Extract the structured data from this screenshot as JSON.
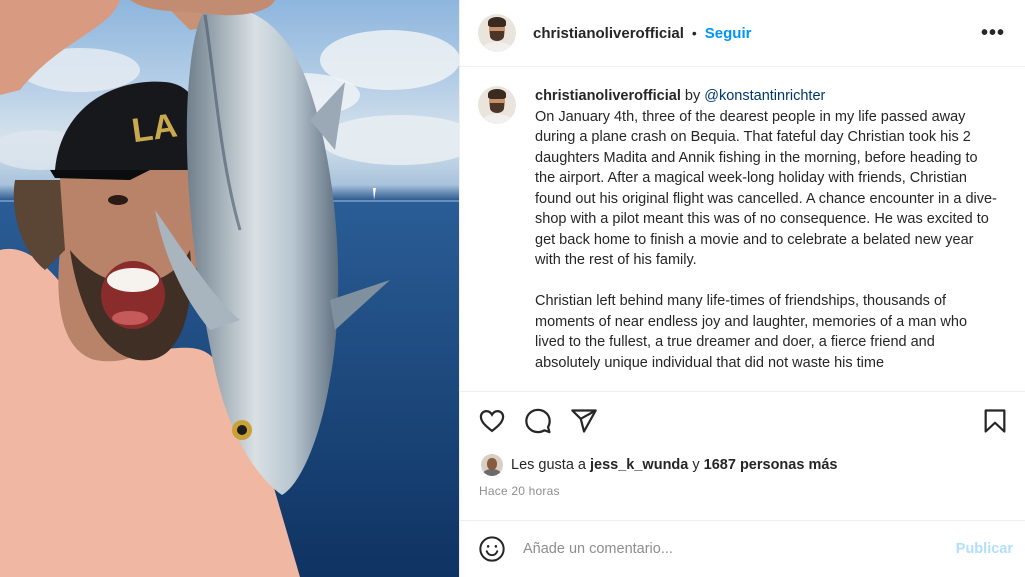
{
  "post": {
    "author": "christianoliverofficial",
    "follow_label": "Seguir",
    "dot": "•",
    "more_label": "•••"
  },
  "caption": {
    "username": "christianoliverofficial",
    "by_text": "by",
    "mention": "@konstantinrichter",
    "paragraph1": "On January 4th, three of the dearest people in my life passed away during a plane crash on Bequia. That fateful day Christian took his 2 daughters Madita and Annik fishing in the morning, before heading to the airport. After a magical week-long holiday with friends, Christian found out his original flight was cancelled. A chance encounter in a dive-shop with a pilot meant this was of no consequence. He was excited to get back home to finish a movie and to celebrate a belated new year with the rest of his family.",
    "paragraph2": "Christian left behind many life-times of friendships, thousands of moments of near endless joy and laughter, memories of a man who lived to the fullest, a true dreamer and doer, a fierce friend and absolutely unique individual that did not waste his time"
  },
  "actions": {
    "like_icon": "heart-icon",
    "comment_icon": "comment-icon",
    "share_icon": "share-icon",
    "save_icon": "bookmark-icon"
  },
  "likes": {
    "prefix": "Les gusta a",
    "user": "jess_k_wunda",
    "connector": "y",
    "others": "1687 personas más"
  },
  "timestamp": "Hace 20 horas",
  "add_comment": {
    "emoji_icon": "smiley-icon",
    "placeholder": "Añade un comentario...",
    "post_label": "Publicar"
  },
  "photo": {
    "cap_text": "LA"
  },
  "colors": {
    "accent": "#0095f6",
    "post_disabled": "#b2dffc",
    "mention": "#00376b"
  }
}
